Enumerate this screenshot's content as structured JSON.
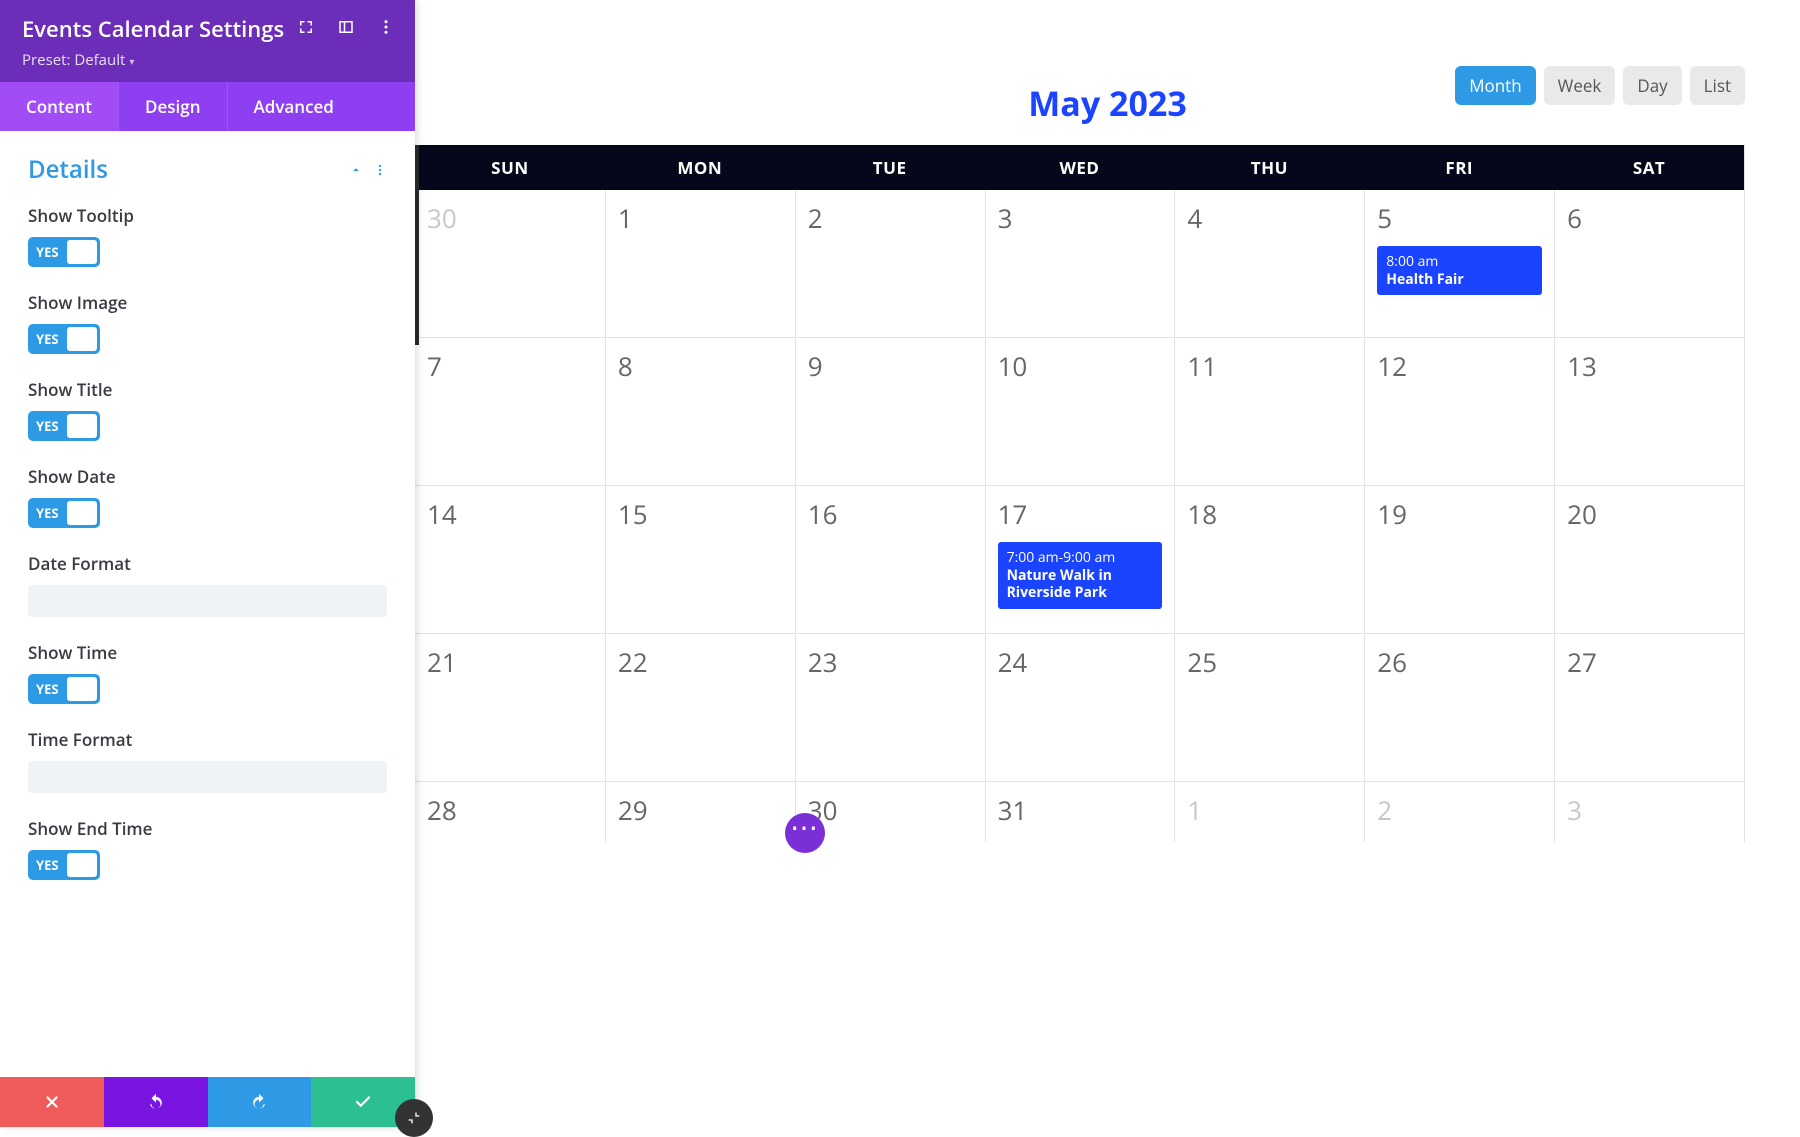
{
  "panel": {
    "title": "Events Calendar Settings",
    "preset": "Preset: Default",
    "tabs": {
      "content": "Content",
      "design": "Design",
      "advanced": "Advanced"
    },
    "section_title": "Details",
    "fields": {
      "show_tooltip": {
        "label": "Show Tooltip",
        "toggle": "YES"
      },
      "show_image": {
        "label": "Show Image",
        "toggle": "YES"
      },
      "show_title": {
        "label": "Show Title",
        "toggle": "YES"
      },
      "show_date": {
        "label": "Show Date",
        "toggle": "YES"
      },
      "date_format": {
        "label": "Date Format",
        "value": ""
      },
      "show_time": {
        "label": "Show Time",
        "toggle": "YES"
      },
      "time_format": {
        "label": "Time Format",
        "value": ""
      },
      "show_end_time": {
        "label": "Show End Time",
        "toggle": "YES"
      }
    }
  },
  "calendar": {
    "title": "May 2023",
    "views": {
      "month": "Month",
      "week": "Week",
      "day": "Day",
      "list": "List"
    },
    "dayhead": [
      "SUN",
      "MON",
      "TUE",
      "WED",
      "THU",
      "FRI",
      "SAT"
    ],
    "weeks": [
      [
        {
          "n": "30",
          "outside": true
        },
        {
          "n": "1"
        },
        {
          "n": "2"
        },
        {
          "n": "3"
        },
        {
          "n": "4"
        },
        {
          "n": "5",
          "event": {
            "time": "8:00 am",
            "title": "Health Fair"
          }
        },
        {
          "n": "6"
        }
      ],
      [
        {
          "n": "7"
        },
        {
          "n": "8"
        },
        {
          "n": "9"
        },
        {
          "n": "10"
        },
        {
          "n": "11"
        },
        {
          "n": "12"
        },
        {
          "n": "13"
        }
      ],
      [
        {
          "n": "14"
        },
        {
          "n": "15"
        },
        {
          "n": "16"
        },
        {
          "n": "17",
          "event": {
            "time": "7:00 am-9:00 am",
            "title": "Nature Walk in Riverside Park"
          }
        },
        {
          "n": "18"
        },
        {
          "n": "19"
        },
        {
          "n": "20"
        }
      ],
      [
        {
          "n": "21"
        },
        {
          "n": "22"
        },
        {
          "n": "23"
        },
        {
          "n": "24"
        },
        {
          "n": "25"
        },
        {
          "n": "26"
        },
        {
          "n": "27"
        }
      ],
      [
        {
          "n": "28"
        },
        {
          "n": "29"
        },
        {
          "n": "30"
        },
        {
          "n": "31"
        },
        {
          "n": "1",
          "outside": true
        },
        {
          "n": "2",
          "outside": true
        },
        {
          "n": "3",
          "outside": true
        }
      ]
    ]
  }
}
